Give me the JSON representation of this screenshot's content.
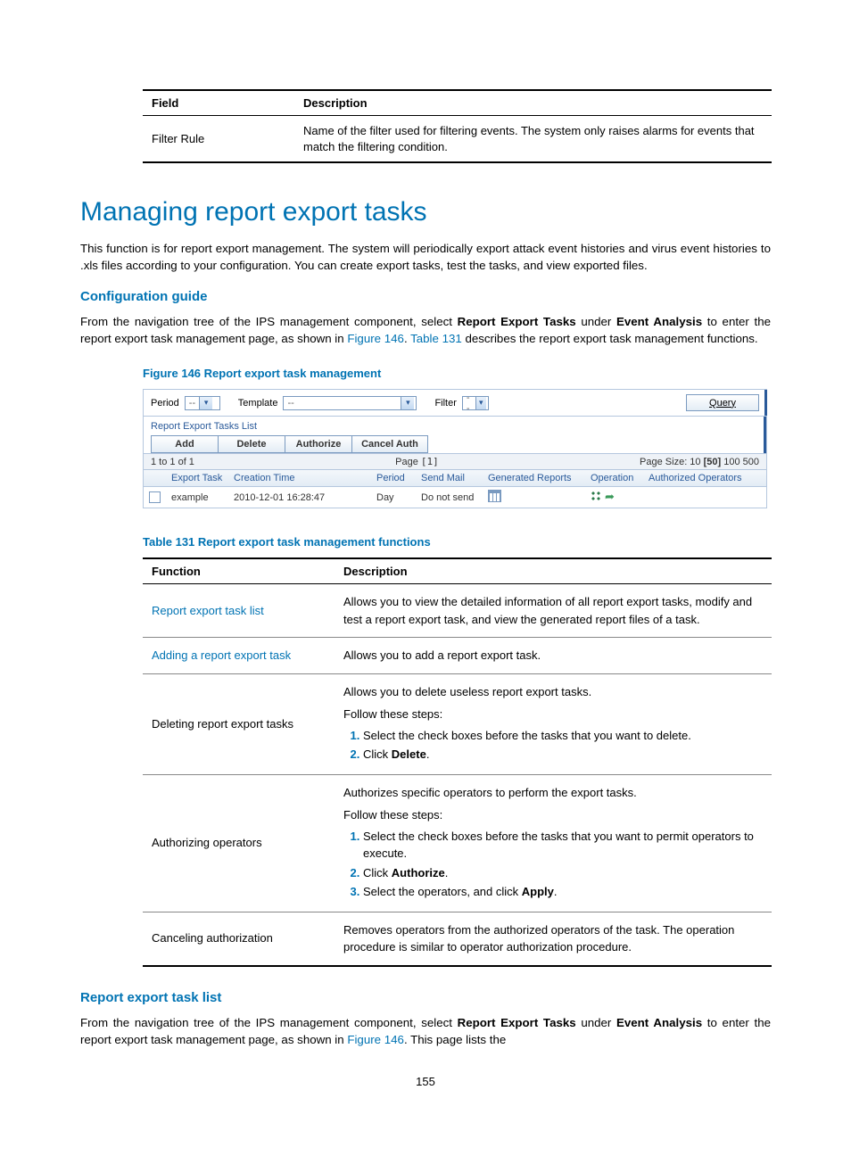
{
  "topTable": {
    "headers": [
      "Field",
      "Description"
    ],
    "row": {
      "field": "Filter Rule",
      "desc": "Name of the filter used for filtering events. The system only raises alarms for events that match the filtering condition."
    }
  },
  "h1": "Managing report export tasks",
  "intro": "This function is for report export management. The system will periodically export attack event histories and virus event histories to .xls files according to your configuration. You can create export tasks, test the tasks, and view exported files.",
  "h2_config": "Configuration guide",
  "config_para": {
    "pre": "From the navigation tree of the IPS management component, select ",
    "bold1": "Report Export Tasks",
    "mid1": " under ",
    "bold2": "Event Analysis",
    "mid2": " to enter the report export task management page, as shown in ",
    "link1": "Figure 146",
    "mid3": ". ",
    "link2": "Table 131",
    "post": " describes the report export task management functions."
  },
  "fig_caption": "Figure 146 Report export task management",
  "figure": {
    "toolbar": {
      "period_label": "Period",
      "period_value": "--",
      "template_label": "Template",
      "template_value": "--",
      "filter_label": "Filter",
      "filter_value": "--",
      "query_btn": "Query"
    },
    "list_title": "Report Export Tasks List",
    "buttons": [
      "Add",
      "Delete",
      "Authorize",
      "Cancel Auth"
    ],
    "pager": {
      "left": "1 to 1 of 1",
      "center_pre": "Page ",
      "center_val": "[1]",
      "right_pre": "Page Size: 10 ",
      "right_sel": "[50]",
      "right_post": " 100 500"
    },
    "cols": [
      "",
      "Export Task",
      "Creation Time",
      "Period",
      "Send Mail",
      "Generated Reports",
      "Operation",
      "Authorized Operators"
    ],
    "row": {
      "name": "example",
      "ctime": "2010-12-01 16:28:47",
      "period": "Day",
      "mail": "Do not send"
    }
  },
  "t131_caption": "Table 131 Report export task management functions",
  "t131": {
    "headers": [
      "Function",
      "Description"
    ],
    "rows": {
      "r1": {
        "func": "Report export task list",
        "desc": "Allows you to view the detailed information of all report export tasks, modify and test a report export task, and view the generated report files of a task."
      },
      "r2": {
        "func": "Adding a report export task",
        "desc": "Allows you to add a report export task."
      },
      "r3": {
        "func": "Deleting report export tasks",
        "desc_line1": "Allows you to delete useless report export tasks.",
        "steps_intro": "Follow these steps:",
        "s1": "Select the check boxes before the tasks that you want to delete.",
        "s2_pre": "Click ",
        "s2_bold": "Delete",
        "s2_post": "."
      },
      "r4": {
        "func": "Authorizing operators",
        "desc_line1": "Authorizes specific operators to perform the export tasks.",
        "steps_intro": "Follow these steps:",
        "s1": "Select the check boxes before the tasks that you want to permit operators to execute.",
        "s2_pre": "Click ",
        "s2_bold": "Authorize",
        "s2_post": ".",
        "s3_pre": "Select the operators, and click ",
        "s3_bold": "Apply",
        "s3_post": "."
      },
      "r5": {
        "func": "Canceling authorization",
        "desc": "Removes operators from the authorized operators of the task. The operation procedure is similar to operator authorization procedure."
      }
    }
  },
  "h2_list": "Report export task list",
  "list_para": {
    "pre": "From the navigation tree of the IPS management component, select ",
    "bold1": "Report Export Tasks",
    "mid1": " under ",
    "bold2": "Event Analysis",
    "mid2": " to enter the report export task management page, as shown in ",
    "link1": "Figure 146",
    "post": ". This page lists the"
  },
  "page_num": "155"
}
